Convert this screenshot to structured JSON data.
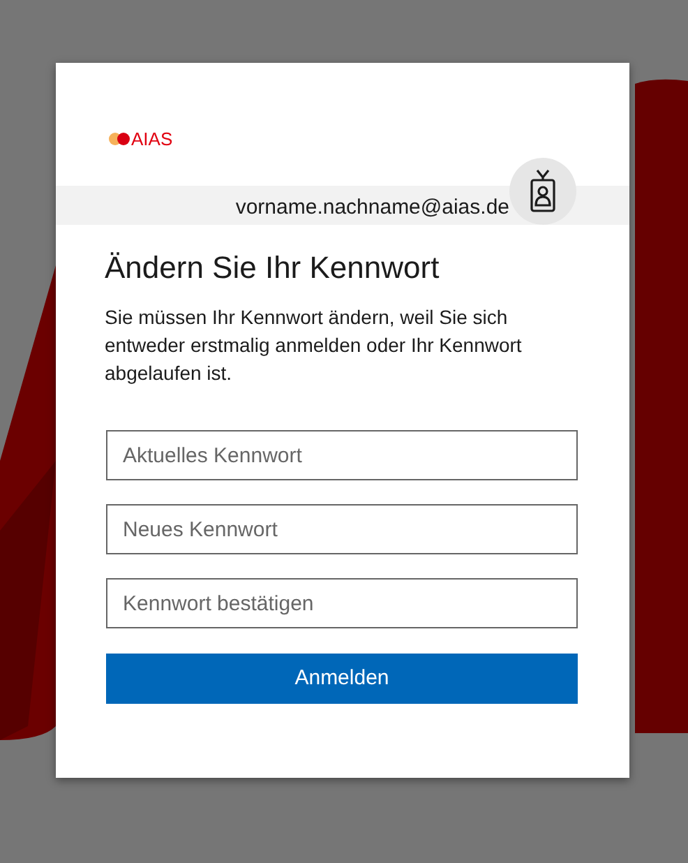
{
  "logo": {
    "text": "AIAS"
  },
  "account": {
    "email": "vorname.nachname@aias.de"
  },
  "title": "Ändern Sie Ihr Kennwort",
  "description": "Sie müssen Ihr Kennwort ändern, weil Sie sich entweder erstmalig anmelden oder Ihr Kennwort abgelaufen ist.",
  "fields": [
    {
      "placeholder": "Aktuelles Kennwort"
    },
    {
      "placeholder": "Neues Kennwort"
    },
    {
      "placeholder": "Kennwort bestätigen"
    }
  ],
  "button": "Anmelden"
}
